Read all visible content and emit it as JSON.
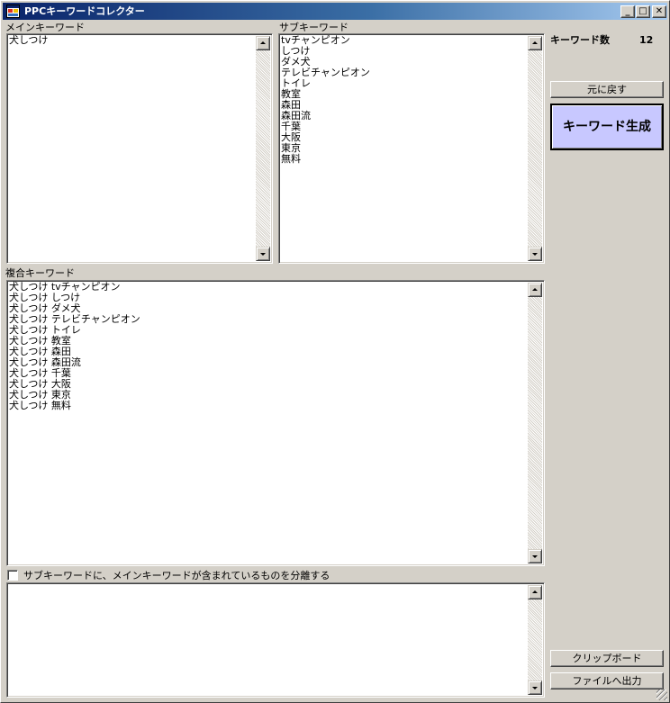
{
  "window": {
    "title": "PPCキーワードコレクター",
    "minimize": "_",
    "maximize": "□",
    "close": "✕"
  },
  "main_keyword": {
    "label": "メインキーワード",
    "items": [
      "犬しつけ"
    ]
  },
  "sub_keyword": {
    "label": "サブキーワード",
    "items": [
      "tvチャンピオン",
      "しつけ",
      "ダメ犬",
      "テレビチャンピオン",
      "トイレ",
      "教室",
      "森田",
      "森田流",
      "千葉",
      "大阪",
      "東京",
      "無料"
    ]
  },
  "keyword_count": {
    "label": "キーワード数",
    "value": "12"
  },
  "buttons": {
    "undo": "元に戻す",
    "generate": "キーワード生成",
    "clipboard": "クリップボード",
    "export": "ファイルへ出力"
  },
  "combined_keyword": {
    "label": "複合キーワード",
    "items": [
      "犬しつけ tvチャンピオン",
      "犬しつけ しつけ",
      "犬しつけ ダメ犬",
      "犬しつけ テレビチャンピオン",
      "犬しつけ トイレ",
      "犬しつけ 教室",
      "犬しつけ 森田",
      "犬しつけ 森田流",
      "犬しつけ 千葉",
      "犬しつけ 大阪",
      "犬しつけ 東京",
      "犬しつけ 無料"
    ]
  },
  "separate_option": {
    "label": "サブキーワードに、メインキーワードが含まれているものを分離する",
    "checked": false
  },
  "separated": {
    "items": []
  },
  "colors": {
    "title_start": "#0a246a",
    "title_end": "#a6caf0",
    "generate_bg": "#c8c8ff",
    "face": "#d4d0c8"
  }
}
